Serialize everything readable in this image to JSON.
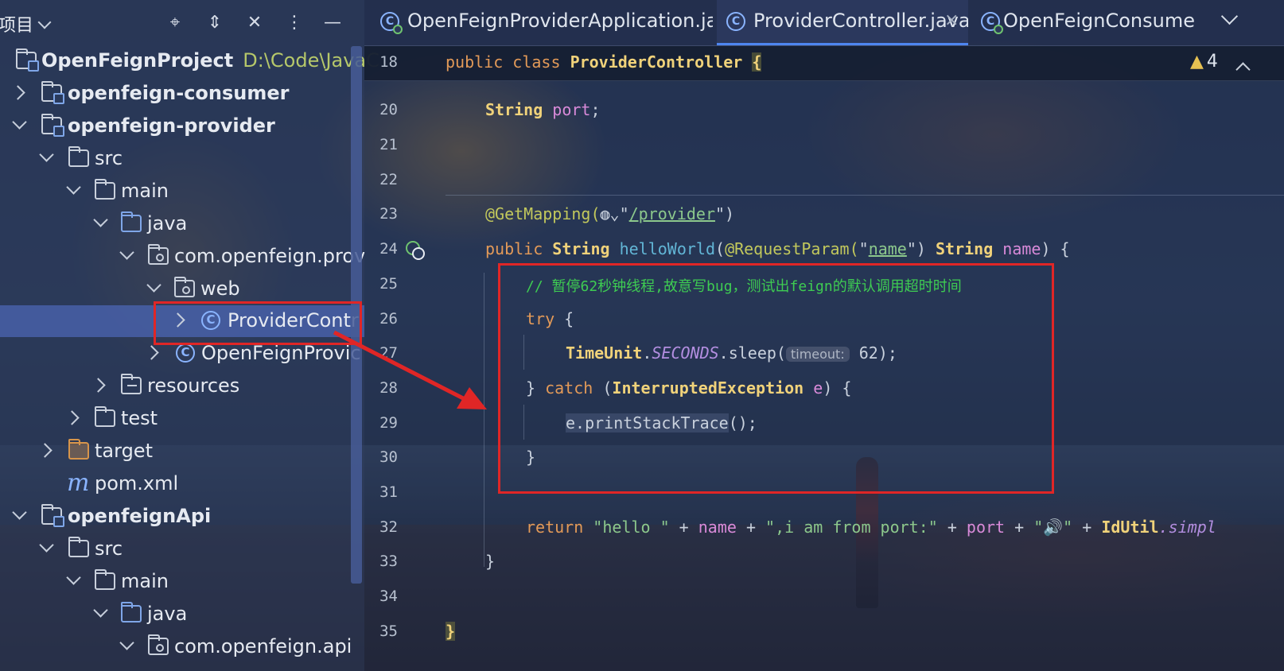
{
  "project_panel": {
    "title": "项目",
    "tree": [
      {
        "label": "OpenFeignProject",
        "path": "D:\\Code\\JavaC",
        "bold": true
      },
      {
        "label": "openfeign-consumer",
        "bold": true
      },
      {
        "label": "openfeign-provider",
        "bold": true
      },
      {
        "label": "src"
      },
      {
        "label": "main"
      },
      {
        "label": "java"
      },
      {
        "label": "com.openfeign.prov"
      },
      {
        "label": "web"
      },
      {
        "label": "ProviderContr"
      },
      {
        "label": "OpenFeignProvic"
      },
      {
        "label": "resources"
      },
      {
        "label": "test"
      },
      {
        "label": "target"
      },
      {
        "label": "pom.xml"
      },
      {
        "label": "openfeignApi",
        "bold": true
      },
      {
        "label": "src"
      },
      {
        "label": "main"
      },
      {
        "label": "java"
      },
      {
        "label": "com.openfeign.api"
      }
    ]
  },
  "tabs": [
    {
      "label": "OpenFeignProviderApplication.java",
      "icon": "spring-app-class-icon"
    },
    {
      "label": "ProviderController.java",
      "icon": "class-icon",
      "active": true,
      "close": "×"
    },
    {
      "label": "OpenFeignConsumerAp",
      "icon": "spring-app-class-icon"
    }
  ],
  "editor": {
    "warnings": "4",
    "sticky_line": {
      "num": "18"
    },
    "line_numbers": [
      "20",
      "21",
      "22",
      "23",
      "24",
      "25",
      "26",
      "27",
      "28",
      "29",
      "30",
      "31",
      "32",
      "33",
      "34",
      "35"
    ],
    "code": {
      "l18_public": "public",
      "l18_class": "class",
      "l18_name": "ProviderController",
      "l18_brace": "{",
      "l20_type": "String",
      "l20_field": "port",
      "l23_anno": "@GetMapping(",
      "l23_str": "/provider",
      "l24_public": "public",
      "l24_type": "String",
      "l24_fn": "helloWorld",
      "l24_anno": "@RequestParam(",
      "l24_param_str": "name",
      "l24_type2": "String",
      "l24_param": "name",
      "l25_comment": "// 暂停62秒钟线程,故意写bug，测试出feign的默认调用超时时间",
      "l26_try": "try",
      "l27_cls": "TimeUnit",
      "l27_const": "SECONDS",
      "l27_method": ".sleep(",
      "l27_hint": "timeout:",
      "l27_val": "62",
      "l28_catch": "catch",
      "l28_type": "InterruptedException",
      "l28_var": "e",
      "l29_call": "e.printStackTrace",
      "l32_return": "return",
      "l32_s1": "\"hello \"",
      "l32_name": "name",
      "l32_s2": "\",i am from port:\"",
      "l32_port": "port",
      "l32_s3": "\"🔊\"",
      "l32_util": "IdUtil",
      "l32_simpl": ".simpl"
    }
  },
  "colors": {
    "annotation": "#e02626",
    "accent": "#4e86f0"
  }
}
